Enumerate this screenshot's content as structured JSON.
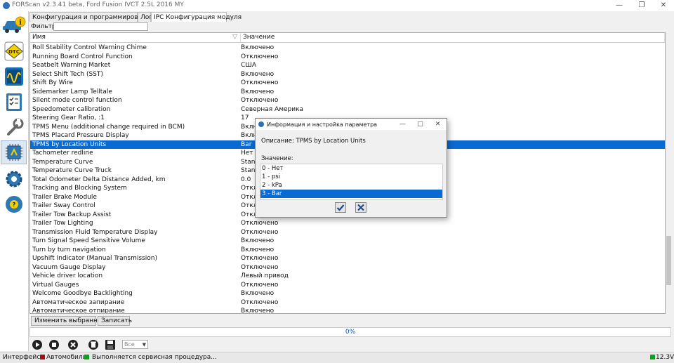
{
  "window": {
    "title": "FORScan v2.3.41 beta, Ford Fusion IVCT 2.5L 2016 MY",
    "minimize": "—",
    "maximize": "❐",
    "close": "✕"
  },
  "tabs": [
    {
      "label": "Конфигурация и программирование"
    },
    {
      "label": "Лог"
    },
    {
      "label": "IPC Конфигурация модуля"
    }
  ],
  "filter": {
    "label": "Фильтр:",
    "value": ""
  },
  "grid": {
    "col_name": "Имя",
    "col_value": "Значение",
    "rows": [
      {
        "name": "Roll Stability Control Warning Chime",
        "value": "Включено"
      },
      {
        "name": "Running Board Control Function",
        "value": "Отключено"
      },
      {
        "name": "Seatbelt Warning Market",
        "value": "США"
      },
      {
        "name": "Select Shift Tech (SST)",
        "value": "Включено"
      },
      {
        "name": "Shift By Wire",
        "value": "Отключено"
      },
      {
        "name": "Sidemarker Lamp Telltale",
        "value": "Включено"
      },
      {
        "name": "Silent mode control function",
        "value": "Отключено"
      },
      {
        "name": "Speedometer calibration",
        "value": "Северная Америка"
      },
      {
        "name": "Steering Gear Ratio, :1",
        "value": "17"
      },
      {
        "name": "TPMS Menu (additional change required in BCM)",
        "value": "Вклю"
      },
      {
        "name": "TPMS Placard Pressure Display",
        "value": "Вклю"
      },
      {
        "name": "TPMS by Location Units",
        "value": "Bar"
      },
      {
        "name": "Tachometer redline",
        "value": "Нет"
      },
      {
        "name": "Temperature Curve",
        "value": "Stand"
      },
      {
        "name": "Temperature Curve Truck",
        "value": "Stand"
      },
      {
        "name": "Total Odometer Delta Distance Added, km",
        "value": "0.0"
      },
      {
        "name": "Tracking and Blocking System",
        "value": "Откл"
      },
      {
        "name": "Trailer Brake Module",
        "value": "Откл"
      },
      {
        "name": "Trailer Sway Control",
        "value": "Откл"
      },
      {
        "name": "Trailer Tow Backup Assist",
        "value": "Откл"
      },
      {
        "name": "Trailer Tow Lighting",
        "value": "Отключено"
      },
      {
        "name": "Transmission Fluid Temperature Display",
        "value": "Отключено"
      },
      {
        "name": "Turn Signal Speed Sensitive Volume",
        "value": "Включено"
      },
      {
        "name": "Turn by turn navigation",
        "value": "Включено"
      },
      {
        "name": "Upshift Indicator (Manual Transmission)",
        "value": "Отключено"
      },
      {
        "name": "Vacuum Gauge Display",
        "value": "Отключено"
      },
      {
        "name": "Vehicle driver location",
        "value": "Левый привод"
      },
      {
        "name": "Virtual Gauges",
        "value": "Отключено"
      },
      {
        "name": "Welcome Goodbye Backlighting",
        "value": "Включено"
      },
      {
        "name": "Автоматическое запирание",
        "value": "Отключено"
      },
      {
        "name": "Автоматическое отпирание",
        "value": "Включено"
      }
    ]
  },
  "buttons": {
    "change_selected": "Изменить выбранное",
    "write": "Записать"
  },
  "progress": {
    "label": "0%",
    "fraction": 0
  },
  "toolbar": {
    "select_value": "Все"
  },
  "status": {
    "interface_label": "Интерфейс:",
    "car_label": "Автомобиль:",
    "message": "Выполняется сервисная процедура...",
    "voltage": "12.3V"
  },
  "dialog": {
    "title": "Информация и настройка параметра",
    "description": "Описание: TPMS by Location Units",
    "value_label": "Значение:",
    "options": [
      "0 - Нет",
      "1 - psi",
      "2 - kPa",
      "3 - Bar"
    ],
    "selected_index": 3
  },
  "colors": {
    "selection": "#0a6ad4",
    "status_red": "#a01010",
    "status_green": "#10a020"
  }
}
